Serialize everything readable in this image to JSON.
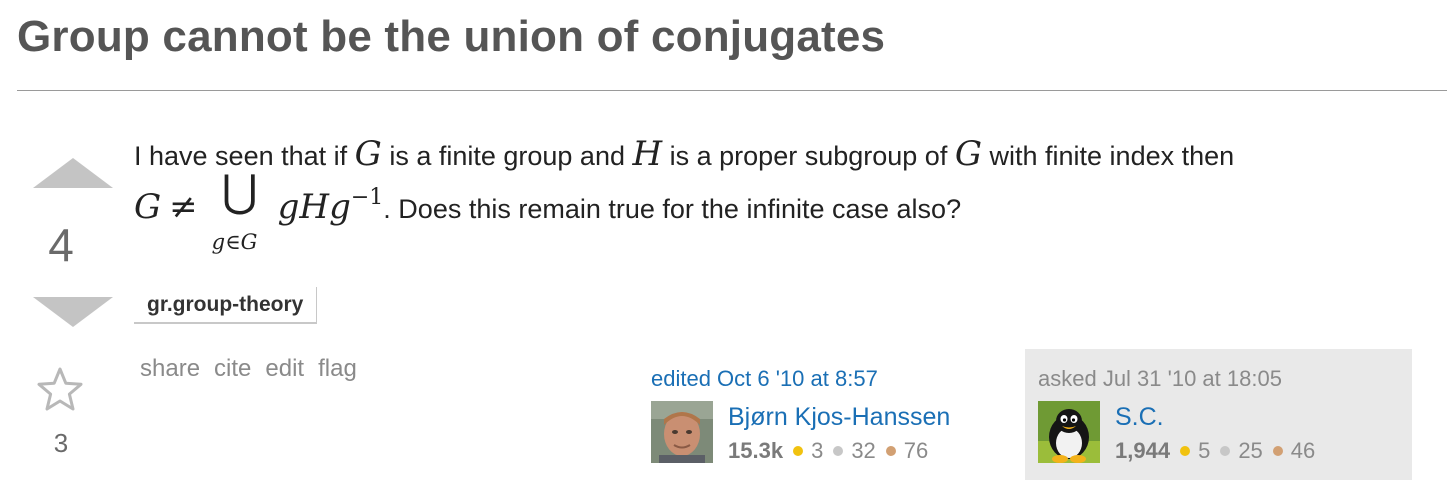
{
  "question": {
    "title": "Group cannot be the union of conjugates",
    "votes": "4",
    "favorites": "3",
    "body": {
      "t1": "I have seen that if ",
      "m_G1": "G",
      "t2": " is a finite group and ",
      "m_H": "H",
      "t3": " is a proper subgroup of ",
      "m_G2": "G",
      "t4": " with finite index then",
      "m_lhs": "G",
      "m_neq": "≠",
      "m_cup": "⋃",
      "m_sub": "g∈G",
      "m_gHg": "gHg",
      "m_exp": "−1",
      "t5": ". Does this remain true for the infinite case also?"
    },
    "tags": [
      "gr.group-theory"
    ]
  },
  "menu": {
    "share": "share",
    "cite": "cite",
    "edit": "edit",
    "flag": "flag"
  },
  "editor": {
    "action": "edited Oct 6 '10 at 8:57",
    "name": "Bjørn Kjos-Hanssen",
    "rep": "15.3k",
    "gold": "3",
    "silver": "32",
    "bronze": "76"
  },
  "asker": {
    "action": "asked Jul 31 '10 at 18:05",
    "name": "S.C.",
    "rep": "1,944",
    "gold": "5",
    "silver": "25",
    "bronze": "46"
  },
  "colors": {
    "gold": "#f1c20f",
    "silver": "#c7c7c7",
    "bronze": "#d2a073",
    "link": "#1a6fb5"
  }
}
